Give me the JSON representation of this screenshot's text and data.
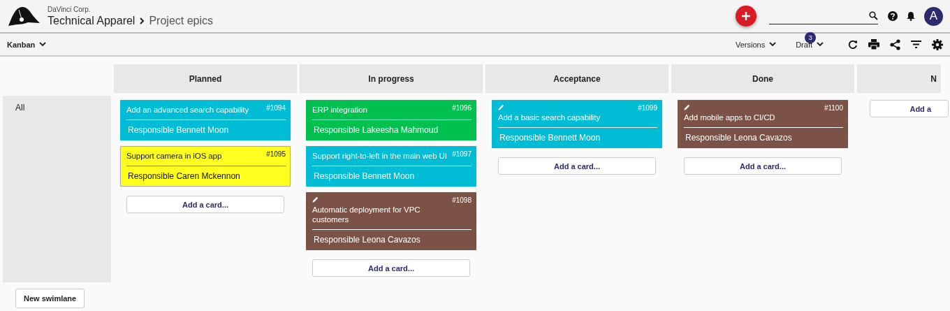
{
  "header": {
    "company": "DaVinci Corp.",
    "project": "Technical Apparel",
    "page": "Project epics",
    "avatar": "A"
  },
  "toolbar": {
    "view": "Kanban",
    "versions": "Versions",
    "draft": "Draft",
    "draft_badge": "3"
  },
  "swimlane": {
    "label": "All",
    "new_button": "New swimlane"
  },
  "columns": [
    {
      "title": "Planned",
      "add": "Add a card...",
      "partial": false,
      "cards": [
        {
          "title": "Add an advanced search capability",
          "number": "#1094",
          "responsible": "Responsible Bennett Moon",
          "color": "#00bcd4",
          "pencil": false
        },
        {
          "title": "Support camera in iOS app",
          "number": "#1095",
          "responsible": "Responsible Caren Mckennon",
          "color": "#ffff1f",
          "pencil": false
        }
      ]
    },
    {
      "title": "In progress",
      "add": "Add a card...",
      "partial": false,
      "cards": [
        {
          "title": "ERP integration",
          "number": "#1096",
          "responsible": "Responsible Lakeesha Mahmoud",
          "color": "#00c04f",
          "pencil": false
        },
        {
          "title": "Support right-to-left in the main web UI",
          "number": "#1097",
          "responsible": "Responsible Bennett Moon",
          "color": "#00bcd4",
          "pencil": false
        },
        {
          "title": "Automatic deployment for VPC customers",
          "number": "#1098",
          "responsible": "Responsible Leona Cavazos",
          "color": "#7b5245",
          "pencil": true
        }
      ]
    },
    {
      "title": "Acceptance",
      "add": "Add a card...",
      "partial": false,
      "cards": [
        {
          "title": "Add a basic search capability",
          "number": "#1099",
          "responsible": "Responsible Bennett Moon",
          "color": "#00bcd4",
          "pencil": true
        }
      ]
    },
    {
      "title": "Done",
      "add": "Add a card...",
      "partial": false,
      "cards": [
        {
          "title": "Add mobile apps to CI/CD",
          "number": "#1100",
          "responsible": "Responsible Leona Cavazos",
          "color": "#7b5245",
          "pencil": true
        }
      ]
    },
    {
      "title": "N",
      "add": "Add a",
      "partial": true
    }
  ]
}
